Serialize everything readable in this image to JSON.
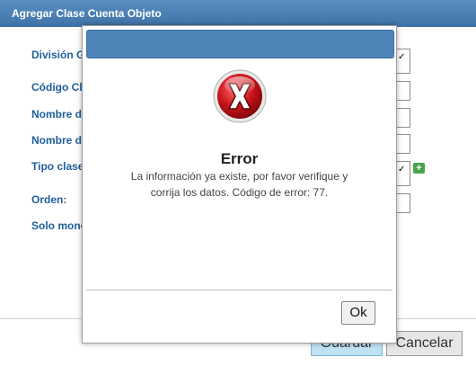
{
  "window": {
    "title": "Agregar Clase Cuenta Objeto"
  },
  "form": {
    "labels": [
      "División G",
      "Código Cla",
      "Nombre de",
      "Nombre de",
      "Tipo clase",
      "Orden:",
      "Solo mone"
    ],
    "add_symbol": "+",
    "dropdown_chevron": "✓"
  },
  "footer": {
    "save_label": "Guardar",
    "cancel_label": "Cancelar"
  },
  "dialog": {
    "icon": "error-x-icon",
    "title": "Error",
    "message": "La información ya existe, por favor verifique y corrija los datos. Código de error: 77.",
    "ok_label": "Ok"
  },
  "colors": {
    "title_bar": "#4a7fb4",
    "label": "#1f5f9c",
    "error_red": "#c9141b",
    "save_bg": "#bfe3f5"
  }
}
